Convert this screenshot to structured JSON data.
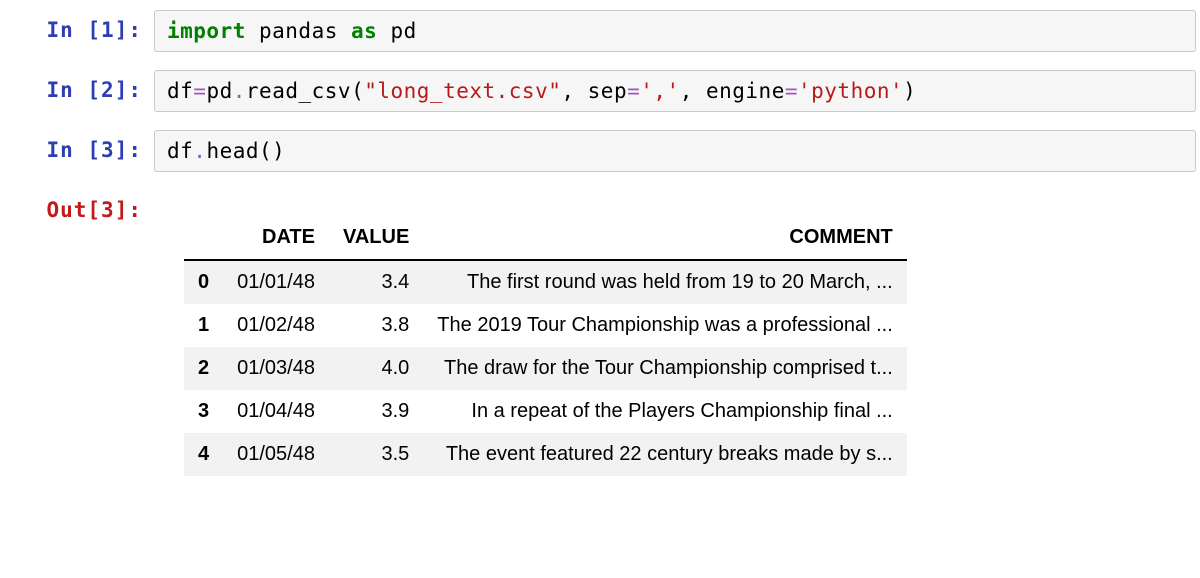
{
  "cells": [
    {
      "in_prompt": "In [1]:",
      "code_tokens": [
        {
          "cls": "kw-green",
          "text": "import"
        },
        {
          "cls": "id-black",
          "text": " pandas "
        },
        {
          "cls": "kw-green",
          "text": "as"
        },
        {
          "cls": "id-black",
          "text": " pd"
        }
      ]
    },
    {
      "in_prompt": "In [2]:",
      "code_tokens": [
        {
          "cls": "id-black",
          "text": "df"
        },
        {
          "cls": "op-purple",
          "text": "="
        },
        {
          "cls": "id-black",
          "text": "pd"
        },
        {
          "cls": "op-purple",
          "text": "."
        },
        {
          "cls": "id-black",
          "text": "read_csv"
        },
        {
          "cls": "paren",
          "text": "("
        },
        {
          "cls": "str-red",
          "text": "\"long_text.csv\""
        },
        {
          "cls": "id-black",
          "text": ", sep"
        },
        {
          "cls": "op-purple",
          "text": "="
        },
        {
          "cls": "str-red",
          "text": "','"
        },
        {
          "cls": "id-black",
          "text": ", engine"
        },
        {
          "cls": "op-purple",
          "text": "="
        },
        {
          "cls": "str-red",
          "text": "'python'"
        },
        {
          "cls": "paren",
          "text": ")"
        }
      ]
    },
    {
      "in_prompt": "In [3]:",
      "code_tokens": [
        {
          "cls": "id-black",
          "text": "df"
        },
        {
          "cls": "op-purple",
          "text": "."
        },
        {
          "cls": "id-black",
          "text": "head"
        },
        {
          "cls": "paren",
          "text": "()"
        }
      ],
      "out_prompt": "Out[3]:",
      "dataframe": {
        "columns": [
          "DATE",
          "VALUE",
          "COMMENT"
        ],
        "index": [
          "0",
          "1",
          "2",
          "3",
          "4"
        ],
        "rows": [
          [
            "01/01/48",
            "3.4",
            "The first round was held from 19 to 20 March, ..."
          ],
          [
            "01/02/48",
            "3.8",
            "The 2019 Tour Championship was a professional ..."
          ],
          [
            "01/03/48",
            "4.0",
            "The draw for the Tour Championship comprised t..."
          ],
          [
            "01/04/48",
            "3.9",
            "In a repeat of the Players Championship final ..."
          ],
          [
            "01/05/48",
            "3.5",
            "The event featured 22 century breaks made by s..."
          ]
        ]
      }
    }
  ]
}
